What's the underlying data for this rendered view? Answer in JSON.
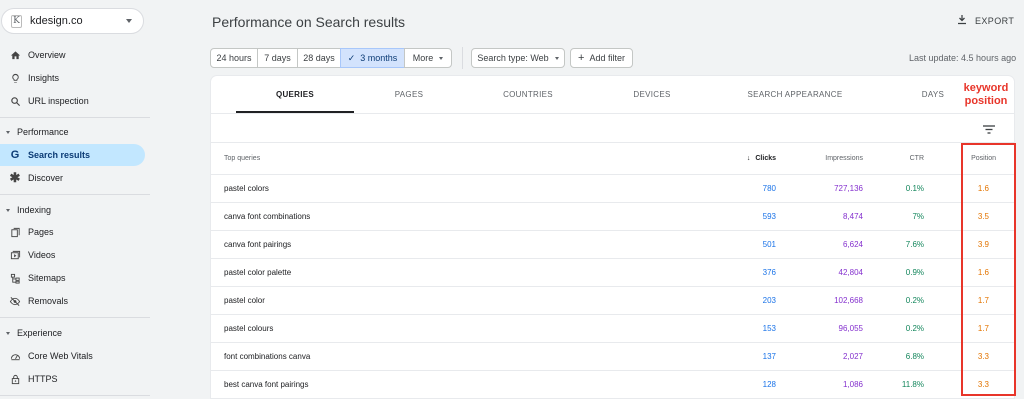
{
  "property": {
    "site": "kdesign.co",
    "logo": "K"
  },
  "sidebar": {
    "top_items": [
      {
        "label": "Overview",
        "icon": "home-icon"
      },
      {
        "label": "Insights",
        "icon": "lightbulb-icon"
      },
      {
        "label": "URL inspection",
        "icon": "search-icon"
      }
    ],
    "sections": [
      {
        "label": "Performance",
        "items": [
          {
            "label": "Search results",
            "icon": "google-g-icon",
            "active": true
          },
          {
            "label": "Discover",
            "icon": "asterisk-icon"
          }
        ]
      },
      {
        "label": "Indexing",
        "items": [
          {
            "label": "Pages",
            "icon": "pages-icon"
          },
          {
            "label": "Videos",
            "icon": "video-icon"
          },
          {
            "label": "Sitemaps",
            "icon": "sitemap-icon"
          },
          {
            "label": "Removals",
            "icon": "eye-off-icon"
          }
        ]
      },
      {
        "label": "Experience",
        "items": [
          {
            "label": "Core Web Vitals",
            "icon": "gauge-icon"
          },
          {
            "label": "HTTPS",
            "icon": "lock-icon"
          }
        ]
      }
    ]
  },
  "header": {
    "title": "Performance on Search results",
    "export_label": "EXPORT"
  },
  "filters": {
    "date_ranges": [
      "24 hours",
      "7 days",
      "28 days",
      "3 months"
    ],
    "selected_range": "3 months",
    "more_label": "More",
    "search_type": "Search type: Web",
    "add_filter": "Add filter",
    "last_update": "Last update: 4.5 hours ago"
  },
  "tabs": [
    "QUERIES",
    "PAGES",
    "COUNTRIES",
    "DEVICES",
    "SEARCH APPEARANCE",
    "DAYS"
  ],
  "table": {
    "headers": {
      "query": "Top queries",
      "clicks": "Clicks",
      "impressions": "Impressions",
      "ctr": "CTR",
      "position": "Position"
    },
    "rows": [
      {
        "query": "pastel colors",
        "clicks": "780",
        "impressions": "727,136",
        "ctr": "0.1%",
        "position": "1.6"
      },
      {
        "query": "canva font combinations",
        "clicks": "593",
        "impressions": "8,474",
        "ctr": "7%",
        "position": "3.5"
      },
      {
        "query": "canva font pairings",
        "clicks": "501",
        "impressions": "6,624",
        "ctr": "7.6%",
        "position": "3.9"
      },
      {
        "query": "pastel color palette",
        "clicks": "376",
        "impressions": "42,804",
        "ctr": "0.9%",
        "position": "1.6"
      },
      {
        "query": "pastel color",
        "clicks": "203",
        "impressions": "102,668",
        "ctr": "0.2%",
        "position": "1.7"
      },
      {
        "query": "pastel colours",
        "clicks": "153",
        "impressions": "96,055",
        "ctr": "0.2%",
        "position": "1.7"
      },
      {
        "query": "font combinations canva",
        "clicks": "137",
        "impressions": "2,027",
        "ctr": "6.8%",
        "position": "3.3"
      },
      {
        "query": "best canva font pairings",
        "clicks": "128",
        "impressions": "1,086",
        "ctr": "11.8%",
        "position": "3.3"
      }
    ]
  },
  "annotation": {
    "line1": "keyword",
    "line2": "position",
    "color": "#e8352a"
  },
  "colors": {
    "clicks": "#1a73e8",
    "impressions": "#8430ce",
    "ctr": "#12855b",
    "position": "#e37400",
    "active_nav": "#c2e7ff"
  }
}
